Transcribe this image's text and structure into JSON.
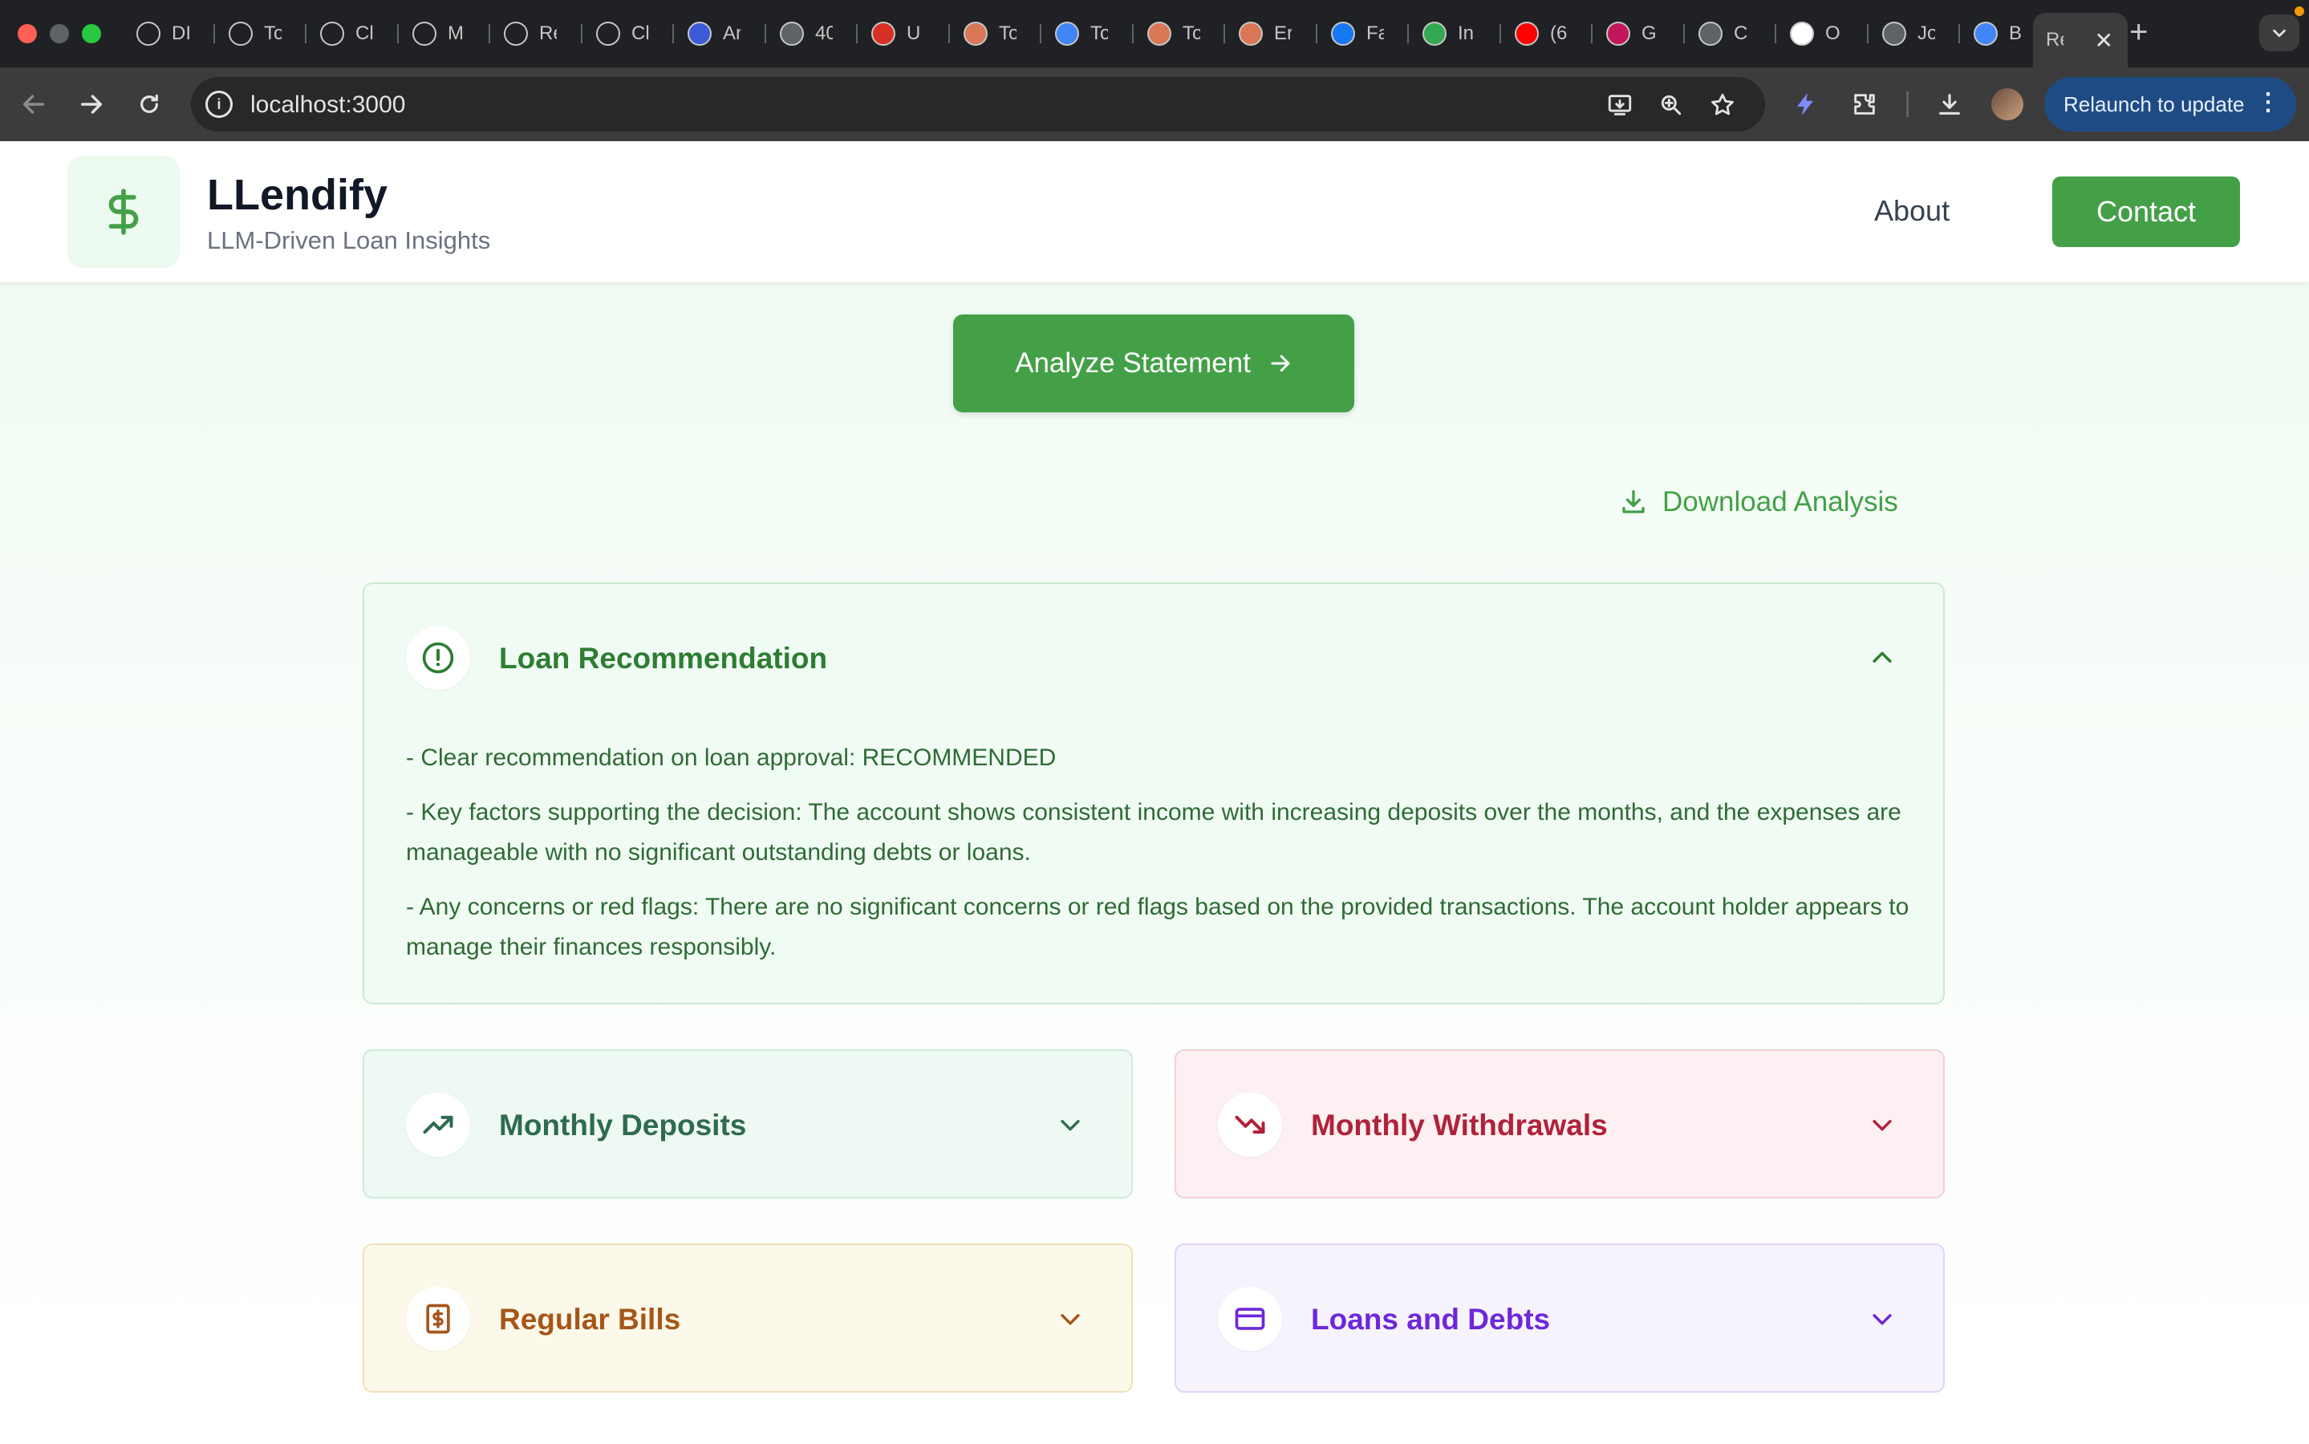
{
  "browser": {
    "tabs": [
      {
        "title": "DI",
        "icon": "openai-icon",
        "color": "#202124"
      },
      {
        "title": "To",
        "icon": "openai-icon",
        "color": "#202124"
      },
      {
        "title": "Cl",
        "icon": "openai-icon",
        "color": "#202124"
      },
      {
        "title": "M",
        "icon": "openai-icon",
        "color": "#202124"
      },
      {
        "title": "Re",
        "icon": "openai-icon",
        "color": "#202124"
      },
      {
        "title": "Cl",
        "icon": "openai-icon",
        "color": "#202124"
      },
      {
        "title": "Ar",
        "icon": "list-icon",
        "color": "#3b5bdb"
      },
      {
        "title": "40",
        "icon": "spiral-icon",
        "color": "#5f6368"
      },
      {
        "title": "U",
        "icon": "infinity-icon",
        "color": "#d93025"
      },
      {
        "title": "To",
        "icon": "asterisk-icon",
        "color": "#d97757"
      },
      {
        "title": "To",
        "icon": "doc-icon",
        "color": "#4285f4"
      },
      {
        "title": "To",
        "icon": "asterisk-icon",
        "color": "#d97757"
      },
      {
        "title": "Er",
        "icon": "asterisk-icon",
        "color": "#d97757"
      },
      {
        "title": "Fa",
        "icon": "facebook-icon",
        "color": "#1877f2"
      },
      {
        "title": "In",
        "icon": "plus-icon",
        "color": "#34a853"
      },
      {
        "title": "(6",
        "icon": "youtube-icon",
        "color": "#ff0000"
      },
      {
        "title": "G",
        "icon": "wave-icon",
        "color": "#c2185b"
      },
      {
        "title": "C",
        "icon": "globe-icon",
        "color": "#5f6368"
      },
      {
        "title": "O",
        "icon": "spiral-icon",
        "color": "#ffffff"
      },
      {
        "title": "Jo",
        "icon": "globe-icon",
        "color": "#5f6368"
      },
      {
        "title": "B",
        "icon": "doc-icon",
        "color": "#4285f4"
      }
    ],
    "active_tab": {
      "title": "Re"
    },
    "new_tab_label": "+",
    "url": "localhost:3000",
    "relaunch_label": "Relaunch to update"
  },
  "header": {
    "logo_symbol": "$",
    "title": "LLendify",
    "subtitle": "LLM-Driven Loan Insights",
    "nav_about": "About",
    "contact_label": "Contact"
  },
  "main": {
    "analyze_label": "Analyze Statement",
    "download_label": "Download Analysis",
    "recommendation": {
      "title": "Loan Recommendation",
      "lines": [
        "- Clear recommendation on loan approval: RECOMMENDED",
        "- Key factors supporting the decision: The account shows consistent income with increasing deposits over the months, and the expenses are manageable with no significant outstanding debts or loans.",
        "- Any concerns or red flags: There are no significant concerns or red flags based on the provided transactions. The account holder appears to manage their finances responsibly."
      ]
    },
    "sections": {
      "deposits": {
        "title": "Monthly Deposits",
        "color": "#2e6b4f"
      },
      "withdrawals": {
        "title": "Monthly Withdrawals",
        "color": "#b0223a"
      },
      "bills": {
        "title": "Regular Bills",
        "color": "#a5561a"
      },
      "loans": {
        "title": "Loans and Debts",
        "color": "#6d28d9"
      }
    }
  },
  "colors": {
    "accent_green": "#43a047",
    "chrome_dark": "#202124"
  }
}
